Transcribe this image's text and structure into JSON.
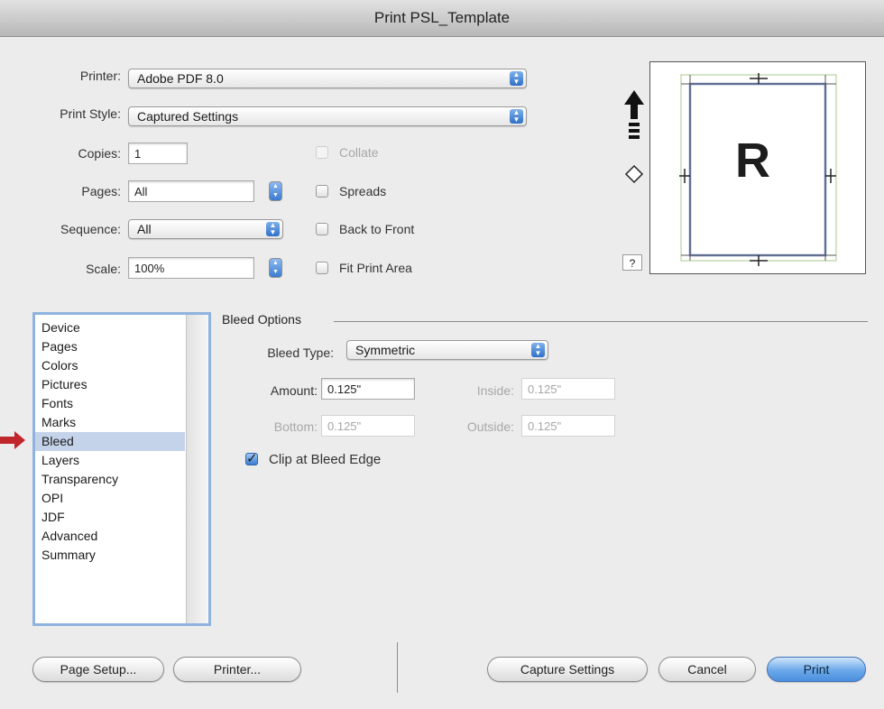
{
  "window": {
    "title": "Print PSL_Template"
  },
  "printer": {
    "label": "Printer:",
    "value": "Adobe PDF 8.0"
  },
  "print_style": {
    "label": "Print Style:",
    "value": "Captured Settings"
  },
  "copies": {
    "label": "Copies:",
    "value": "1"
  },
  "pages": {
    "label": "Pages:",
    "value": "All"
  },
  "sequence": {
    "label": "Sequence:",
    "value": "All"
  },
  "scale": {
    "label": "Scale:",
    "value": "100%"
  },
  "options": {
    "collate": {
      "label": "Collate",
      "checked": false,
      "enabled": false
    },
    "spreads": {
      "label": "Spreads",
      "checked": false
    },
    "back_to_front": {
      "label": "Back to Front",
      "checked": false
    },
    "fit_print_area": {
      "label": "Fit Print Area",
      "checked": false
    }
  },
  "preview": {
    "letter": "R",
    "help": "?"
  },
  "categories": {
    "selected": "Bleed",
    "items": [
      "Device",
      "Pages",
      "Colors",
      "Pictures",
      "Fonts",
      "Marks",
      "Bleed",
      "Layers",
      "Transparency",
      "OPI",
      "JDF",
      "Advanced",
      "Summary"
    ]
  },
  "bleed": {
    "section_title": "Bleed Options",
    "type_label": "Bleed Type:",
    "type_value": "Symmetric",
    "amount_label": "Amount:",
    "amount_value": "0.125\"",
    "inside_label": "Inside:",
    "inside_value": "0.125\"",
    "bottom_label": "Bottom:",
    "bottom_value": "0.125\"",
    "outside_label": "Outside:",
    "outside_value": "0.125\"",
    "clip_label": "Clip at Bleed Edge",
    "clip_checked": true
  },
  "buttons": {
    "page_setup": "Page Setup...",
    "printer": "Printer...",
    "capture_settings": "Capture Settings",
    "cancel": "Cancel",
    "print": "Print"
  },
  "colors": {
    "annotation_arrow": "#c0272d",
    "selection": "#c5d3ea",
    "default_button": "#6aa8ea"
  }
}
